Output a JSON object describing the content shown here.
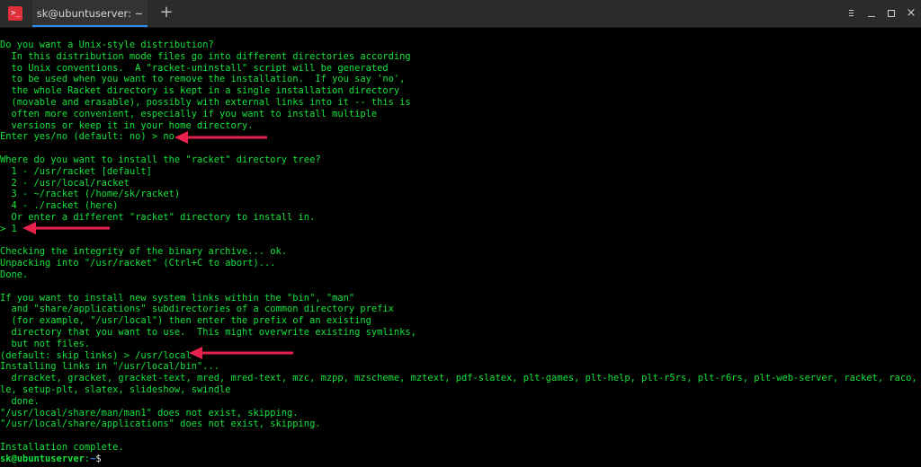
{
  "tab": {
    "title": "sk@ubuntuserver: ~"
  },
  "app_icon": {
    "glyph": ">_",
    "name": "terminal-icon"
  },
  "controls": {
    "new_tab": "+",
    "close": "×"
  },
  "colors": {
    "terminal_text": "#14e33b",
    "prompt_path": "#3f7fff",
    "arrow": "#e8214e",
    "tab_accent": "#2d8cf0"
  },
  "terminal": {
    "lines": [
      "Do you want a Unix-style distribution?",
      "  In this distribution mode files go into different directories according",
      "  to Unix conventions.  A \"racket-uninstall\" script will be generated",
      "  to be used when you want to remove the installation.  If you say 'no',",
      "  the whole Racket directory is kept in a single installation directory",
      "  (movable and erasable), possibly with external links into it -- this is",
      "  often more convenient, especially if you want to install multiple",
      "  versions or keep it in your home directory.",
      "Enter yes/no (default: no) > no",
      "",
      "Where do you want to install the \"racket\" directory tree?",
      "  1 - /usr/racket [default]",
      "  2 - /usr/local/racket",
      "  3 - ~/racket (/home/sk/racket)",
      "  4 - ./racket (here)",
      "  Or enter a different \"racket\" directory to install in.",
      "> 1",
      "",
      "Checking the integrity of the binary archive... ok.",
      "Unpacking into \"/usr/racket\" (Ctrl+C to abort)...",
      "Done.",
      "",
      "If you want to install new system links within the \"bin\", \"man\"",
      "  and \"share/applications\" subdirectories of a common directory prefix",
      "  (for example, \"/usr/local\") then enter the prefix of an existing",
      "  directory that you want to use.  This might overwrite existing symlinks,",
      "  but not files.",
      "(default: skip links) > /usr/local",
      "Installing links in \"/usr/local/bin\"...",
      "  drracket, gracket, gracket-text, mred, mred-text, mzc, mzpp, mzscheme, mztext, pdf-slatex, plt-games, plt-help, plt-r5rs, plt-r6rs, plt-web-server, racket, raco, scribb",
      "le, setup-plt, slatex, slideshow, swindle",
      "  done.",
      "\"/usr/local/share/man/man1\" does not exist, skipping.",
      "\"/usr/local/share/applications\" does not exist, skipping.",
      "",
      "Installation complete."
    ],
    "prompt": {
      "user": "sk@ubuntuserver",
      "sep": ":",
      "path": "~",
      "symbol": "$"
    }
  }
}
